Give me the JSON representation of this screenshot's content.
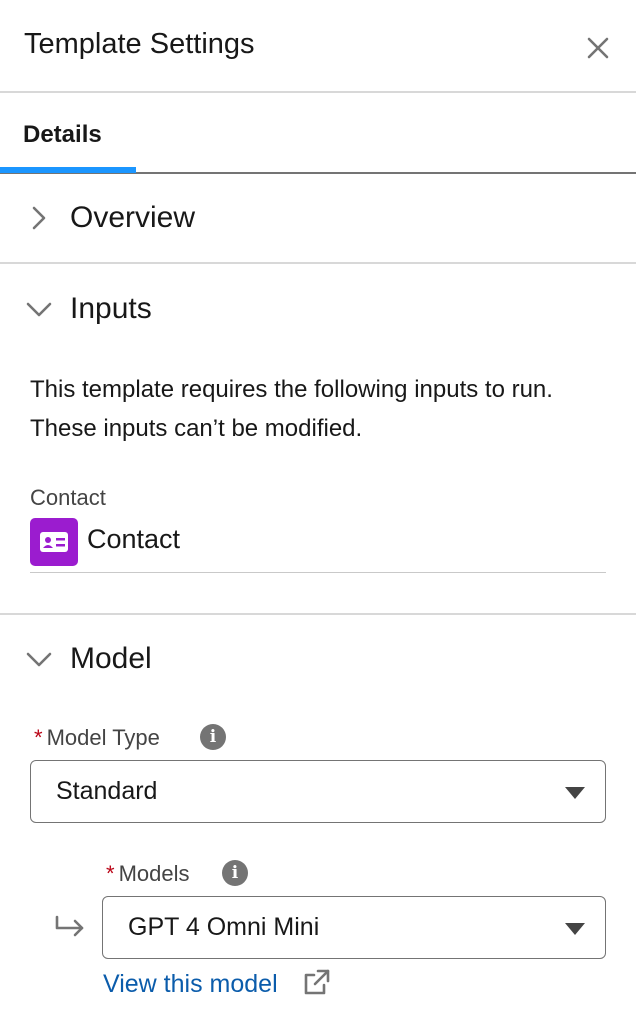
{
  "header": {
    "title": "Template Settings",
    "close_icon": "close-icon"
  },
  "tabs": [
    {
      "label": "Details",
      "active": true
    }
  ],
  "sections": {
    "overview": {
      "title": "Overview",
      "expanded": false
    },
    "inputs": {
      "title": "Inputs",
      "expanded": true,
      "description": "This template requires the following inputs to run. These inputs can’t be modified.",
      "contact_label": "Contact",
      "contact_value": "Contact",
      "contact_icon": "contact-card-icon",
      "contact_icon_color": "#9b1ccf"
    },
    "model": {
      "title": "Model",
      "expanded": true,
      "model_type_label": "Model Type",
      "model_type_value": "Standard",
      "models_label": "Models",
      "models_value": "GPT 4 Omni Mini",
      "required_marker": "*",
      "info_symbol": "i",
      "view_link": "View this model"
    }
  },
  "colors": {
    "accent": "#1b96ff",
    "required": "#ba0517",
    "link": "#0b5cab"
  }
}
